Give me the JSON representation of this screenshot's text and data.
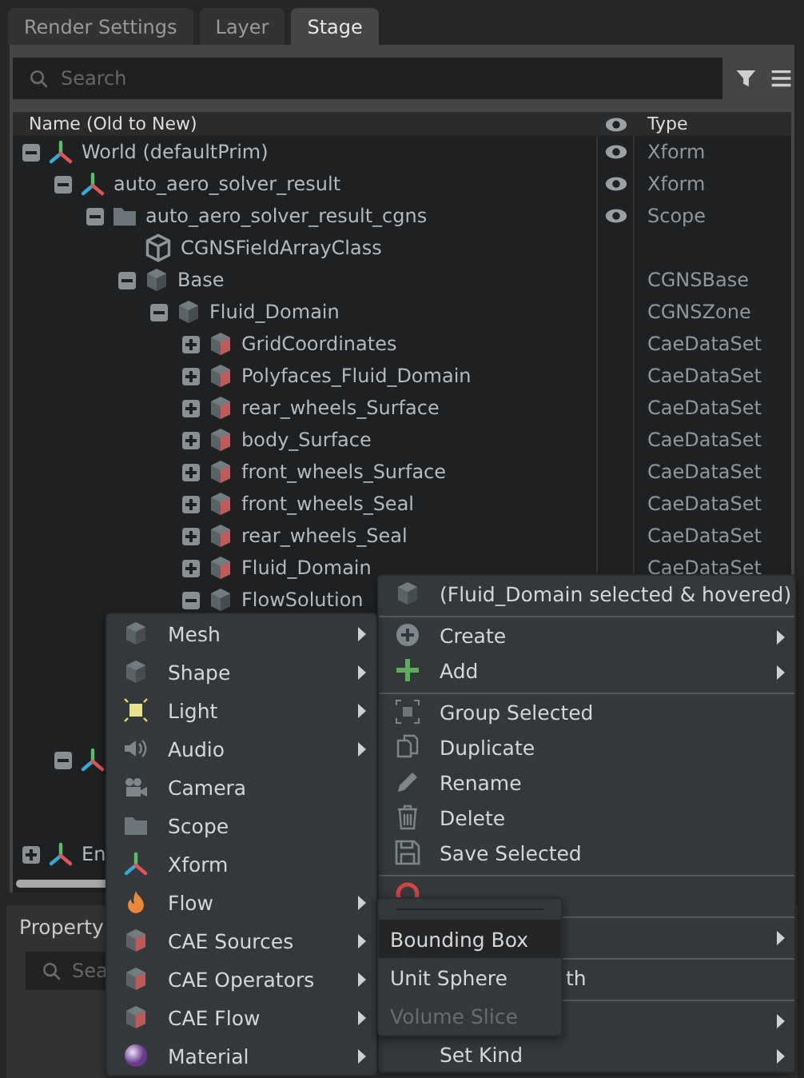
{
  "tabs": [
    {
      "label": "Render Settings",
      "selected": false
    },
    {
      "label": "Layer",
      "selected": false
    },
    {
      "label": "Stage",
      "selected": true
    }
  ],
  "stage_search": {
    "placeholder": "Search"
  },
  "columns": {
    "name": "Name (Old to New)",
    "type": "Type"
  },
  "tree": [
    {
      "label": "World (defaultPrim)",
      "kind": "xform",
      "expanded": true,
      "eye": true,
      "type": "Xform",
      "children": [
        {
          "label": "auto_aero_solver_result",
          "kind": "xform",
          "expanded": true,
          "eye": true,
          "type": "Xform",
          "children": [
            {
              "label": "auto_aero_solver_result_cgns",
              "kind": "scope",
              "expanded": true,
              "eye": true,
              "type": "Scope",
              "children": [
                {
                  "label": "CGNSFieldArrayClass",
                  "kind": "class",
                  "eye": false
                },
                {
                  "label": "Base",
                  "kind": "prim",
                  "expanded": true,
                  "eye": false,
                  "type": "CGNSBase",
                  "children": [
                    {
                      "label": "Fluid_Domain",
                      "kind": "prim",
                      "expanded": true,
                      "eye": false,
                      "type": "CGNSZone",
                      "children": [
                        {
                          "label": "GridCoordinates",
                          "kind": "dataset",
                          "expanded": false,
                          "eye": false,
                          "type": "CaeDataSet"
                        },
                        {
                          "label": "Polyfaces_Fluid_Domain",
                          "kind": "dataset",
                          "expanded": false,
                          "eye": false,
                          "type": "CaeDataSet"
                        },
                        {
                          "label": "rear_wheels_Surface",
                          "kind": "dataset",
                          "expanded": false,
                          "eye": false,
                          "type": "CaeDataSet"
                        },
                        {
                          "label": "body_Surface",
                          "kind": "dataset",
                          "expanded": false,
                          "eye": false,
                          "type": "CaeDataSet"
                        },
                        {
                          "label": "front_wheels_Surface",
                          "kind": "dataset",
                          "expanded": false,
                          "eye": false,
                          "type": "CaeDataSet"
                        },
                        {
                          "label": "front_wheels_Seal",
                          "kind": "dataset",
                          "expanded": false,
                          "eye": false,
                          "type": "CaeDataSet"
                        },
                        {
                          "label": "rear_wheels_Seal",
                          "kind": "dataset",
                          "expanded": false,
                          "eye": false,
                          "type": "CaeDataSet"
                        },
                        {
                          "label": "Fluid_Domain",
                          "kind": "dataset",
                          "expanded": false,
                          "eye": false,
                          "type": "CaeDataSet"
                        },
                        {
                          "label": "FlowSolution",
                          "kind": "prim",
                          "expanded": true,
                          "eye": false
                        }
                      ]
                    }
                  ]
                }
              ]
            }
          ]
        },
        {
          "kind": "xform",
          "expanded": true
        }
      ]
    },
    {
      "label": "En",
      "kind": "xform",
      "expanded": false
    }
  ],
  "property_panel": {
    "title": "Property",
    "search": {
      "placeholder": "Sea"
    }
  },
  "create_menu": [
    {
      "label": "Mesh",
      "kind": "cube",
      "submenu": true
    },
    {
      "label": "Shape",
      "kind": "cube",
      "submenu": true
    },
    {
      "label": "Light",
      "kind": "light",
      "submenu": true
    },
    {
      "label": "Audio",
      "kind": "audio",
      "submenu": true
    },
    {
      "label": "Camera",
      "kind": "camera",
      "submenu": false
    },
    {
      "label": "Scope",
      "kind": "folder",
      "submenu": false
    },
    {
      "label": "Xform",
      "kind": "xform",
      "submenu": false
    },
    {
      "label": "Flow",
      "kind": "flame",
      "submenu": true
    },
    {
      "label": "CAE Sources",
      "kind": "redcube",
      "submenu": true
    },
    {
      "label": "CAE Operators",
      "kind": "redcube",
      "submenu": true
    },
    {
      "label": "CAE Flow",
      "kind": "redcube",
      "submenu": true
    },
    {
      "label": "Material",
      "kind": "sphere",
      "submenu": true
    }
  ],
  "context_menu": [
    {
      "label": "(Fluid_Domain selected & hovered)",
      "kind": "cube",
      "submenu": false,
      "separator_after": true
    },
    {
      "label": "Create",
      "kind": "pluscircle",
      "submenu": true,
      "separator_after": false
    },
    {
      "label": "Add",
      "kind": "plus",
      "submenu": true,
      "separator_after": true
    },
    {
      "label": "Group Selected",
      "kind": "group",
      "submenu": false,
      "separator_after": false
    },
    {
      "label": "Duplicate",
      "kind": "duplicate",
      "submenu": false,
      "separator_after": false
    },
    {
      "label": "Rename",
      "kind": "pencil",
      "submenu": false,
      "separator_after": false
    },
    {
      "label": "Delete",
      "kind": "trash",
      "submenu": false,
      "separator_after": false
    },
    {
      "label": "Save Selected",
      "kind": "save",
      "submenu": false,
      "separator_after": true
    },
    {
      "kind": "redcircle",
      "submenu": false,
      "separator_after": true
    },
    {
      "submenu": true,
      "separator_after": true
    },
    {
      "label": "th",
      "submenu": false,
      "separator_after": true
    },
    {
      "submenu": true,
      "separator_after": false
    },
    {
      "label": "Set Kind",
      "submenu": true,
      "separator_after": false
    }
  ],
  "cae_submenu": [
    {
      "label": "Bounding Box",
      "highlighted": true,
      "disabled": false
    },
    {
      "label": "Unit Sphere",
      "highlighted": false,
      "disabled": false
    },
    {
      "label": "Volume Slice",
      "highlighted": false,
      "disabled": true
    }
  ]
}
